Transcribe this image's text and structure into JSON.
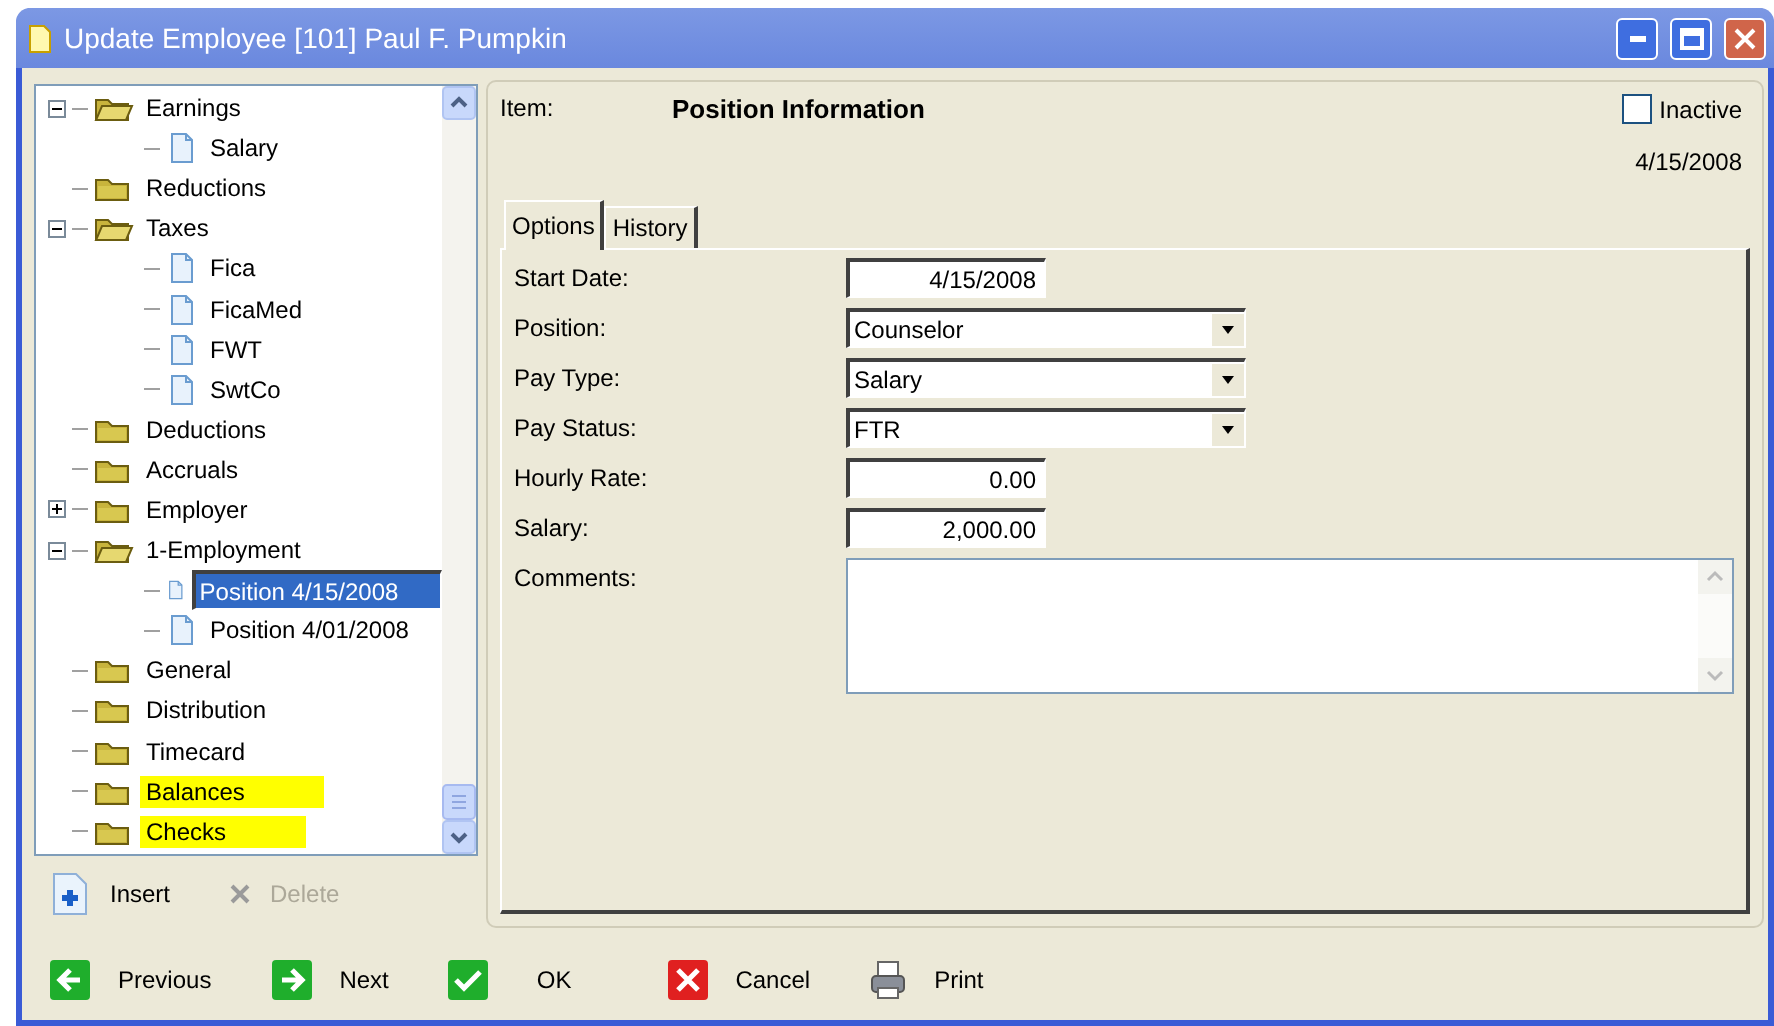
{
  "window": {
    "title": "Update Employee [101] Paul F. Pumpkin"
  },
  "tree": {
    "items": [
      {
        "label": "Earnings",
        "kind": "folder",
        "expanded": true,
        "selected": false,
        "highlighted": false,
        "children": [
          {
            "label": "Salary",
            "kind": "page",
            "selected": false,
            "highlighted": false
          }
        ]
      },
      {
        "label": "Reductions",
        "kind": "folder",
        "selected": false,
        "highlighted": false
      },
      {
        "label": "Taxes",
        "kind": "folder",
        "expanded": true,
        "selected": false,
        "highlighted": false,
        "children": [
          {
            "label": "Fica",
            "kind": "page",
            "selected": false,
            "highlighted": false
          },
          {
            "label": "FicaMed",
            "kind": "page",
            "selected": false,
            "highlighted": false
          },
          {
            "label": "FWT",
            "kind": "page",
            "selected": false,
            "highlighted": false
          },
          {
            "label": "SwtCo",
            "kind": "page",
            "selected": false,
            "highlighted": false
          }
        ]
      },
      {
        "label": "Deductions",
        "kind": "folder",
        "selected": false,
        "highlighted": false
      },
      {
        "label": "Accruals",
        "kind": "folder",
        "selected": false,
        "highlighted": false
      },
      {
        "label": "Employer",
        "kind": "folder",
        "expanded": false,
        "selected": false,
        "highlighted": false
      },
      {
        "label": "1-Employment",
        "kind": "folder",
        "expanded": true,
        "selected": false,
        "highlighted": false,
        "children": [
          {
            "label": "Position 4/15/2008",
            "kind": "page",
            "selected": true,
            "highlighted": false
          },
          {
            "label": "Position 4/01/2008",
            "kind": "page",
            "selected": false,
            "highlighted": false
          }
        ]
      },
      {
        "label": "General",
        "kind": "folder",
        "selected": false,
        "highlighted": false
      },
      {
        "label": "Distribution",
        "kind": "folder",
        "selected": false,
        "highlighted": false
      },
      {
        "label": "Timecard",
        "kind": "folder",
        "selected": false,
        "highlighted": false
      },
      {
        "label": "Balances",
        "kind": "folder",
        "selected": false,
        "highlighted": true
      },
      {
        "label": "Checks",
        "kind": "folder",
        "selected": false,
        "highlighted": true
      }
    ]
  },
  "tree_actions": [
    {
      "label": "Insert",
      "kind": "insert",
      "disabled": false
    },
    {
      "label": "Delete",
      "kind": "delete",
      "disabled": true
    }
  ],
  "detail": {
    "item_label": "Item:",
    "item_value": "Position Information",
    "inactive": {
      "label": "Inactive",
      "checked": false
    },
    "date": "4/15/2008",
    "tabs": [
      {
        "label": "Options",
        "selected": true
      },
      {
        "label": "History",
        "selected": false
      }
    ],
    "fields": [
      {
        "kind": "text",
        "label": "Start Date:",
        "value": "4/15/2008"
      },
      {
        "kind": "select",
        "label": "Position:",
        "value": "Counselor"
      },
      {
        "kind": "select",
        "label": "Pay Type:",
        "value": "Salary"
      },
      {
        "kind": "select",
        "label": "Pay Status:",
        "value": "FTR"
      },
      {
        "kind": "text",
        "label": "Hourly Rate:",
        "value": "0.00"
      },
      {
        "kind": "text",
        "label": "Salary:",
        "value": "2,000.00"
      },
      {
        "kind": "memo",
        "label": "Comments:"
      }
    ]
  },
  "buttons": [
    {
      "label": "Previous",
      "kind": "previous"
    },
    {
      "label": "Next",
      "kind": "next"
    },
    {
      "label": "OK",
      "kind": "ok"
    },
    {
      "label": "Cancel",
      "kind": "cancel"
    },
    {
      "label": "Print",
      "kind": "print"
    }
  ]
}
